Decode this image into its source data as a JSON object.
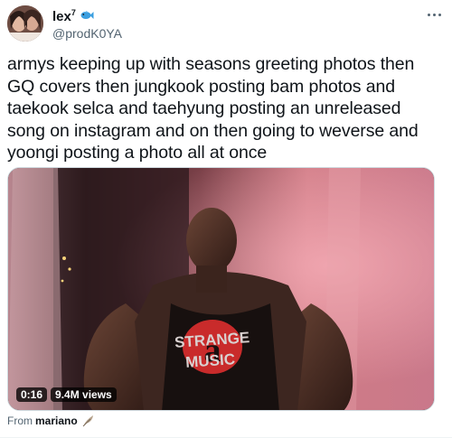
{
  "tweet": {
    "author": {
      "display_name": "lex",
      "display_name_suffix": "7",
      "name_emoji": "fish-icon",
      "handle": "@prodK0YA"
    },
    "more_icon": "more-dots-icon",
    "text": "armys keeping up with seasons greeting photos then\nGQ covers then jungkook posting bam photos and\ntaekook selca and taehyung posting an unreleased\nsong on instagram and on then going to weverse and\nyoongi posting a photo all at once",
    "video": {
      "time": "0:16",
      "views": "9.4M views",
      "shirt_text_line1": "STRANGE",
      "shirt_text_line2": "MUSIC",
      "logo_letter": "a"
    },
    "attribution": {
      "prefix": "From",
      "source": "mariano",
      "icon": "feather-icon"
    }
  },
  "colors": {
    "text_primary": "#0f1419",
    "text_secondary": "#536471",
    "border": "#cfd9de",
    "fish_emoji": "#3b9fe0",
    "shirt_logo": "#d42a2a"
  }
}
